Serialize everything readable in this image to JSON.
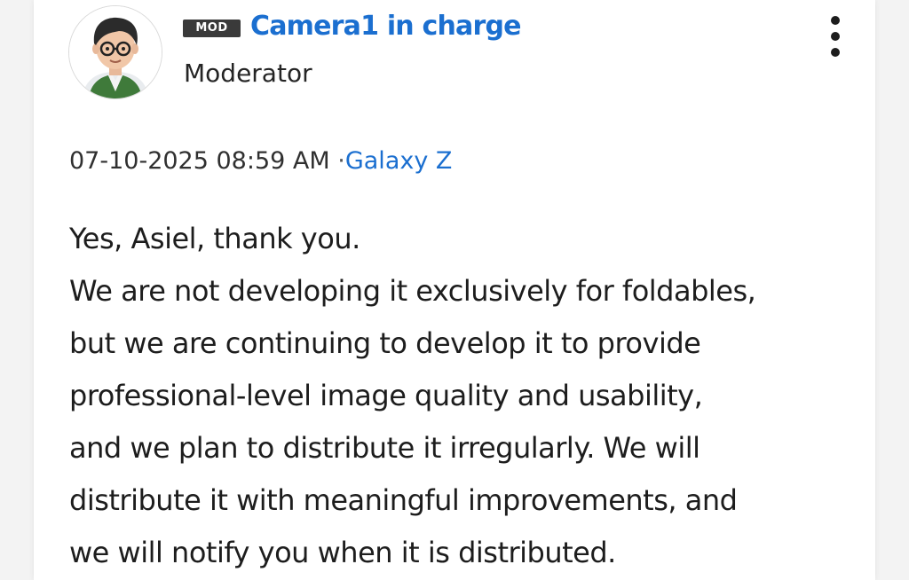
{
  "post": {
    "badge": "MOD",
    "author_name": "Camera1 in charge",
    "author_role": "Moderator",
    "timestamp": "07-10-2025 08:59 AM",
    "separator": "·",
    "board": "Galaxy Z",
    "body_lines": [
      "Yes, Asiel, thank you.",
      "We are not developing it exclusively for foldables,",
      "but we are continuing to develop it to provide",
      "professional-level image quality and usability,",
      "and we plan to distribute it irregularly. We will",
      "distribute it with meaningful improvements, and",
      "we will notify you when it is distributed."
    ]
  },
  "icons": {
    "more": "more-vertical-icon",
    "avatar": "avatar-cartoon"
  },
  "colors": {
    "accent": "#1b6fd0",
    "badge_bg": "#3a3a3a",
    "text": "#1d1d1d"
  }
}
